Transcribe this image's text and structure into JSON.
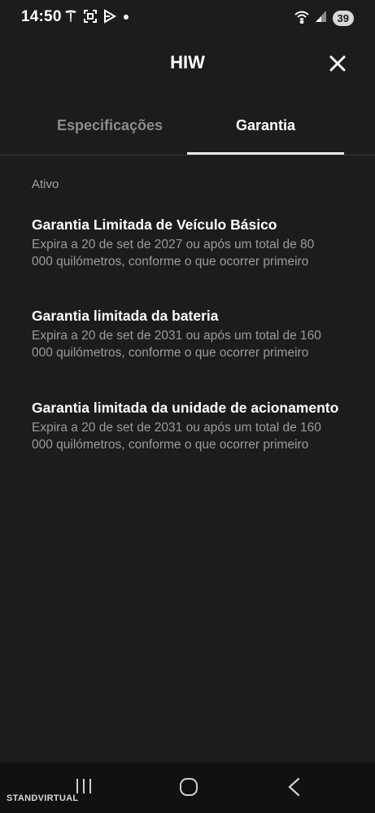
{
  "status_bar": {
    "time": "14:50",
    "left_icons": [
      "tesla-icon",
      "screenshot-icon",
      "play-icon",
      "dot-icon"
    ],
    "right_icons": [
      "wifi-icon",
      "signal-icon"
    ],
    "battery": "39"
  },
  "header": {
    "title": "HIW",
    "close_icon": "close-icon"
  },
  "tabs": [
    {
      "label": "Especificações",
      "active": false
    },
    {
      "label": "Garantia",
      "active": true
    }
  ],
  "section": {
    "label": "Ativo"
  },
  "warranties": [
    {
      "title": "Garantia Limitada de Veículo Básico",
      "description": "Expira a 20 de set de 2027 ou após um total de 80 000 quilómetros, conforme o que ocorrer primeiro"
    },
    {
      "title": "Garantia limitada da bateria",
      "description": "Expira a 20 de set de 2031 ou após um total de 160 000 quilómetros, conforme o que ocorrer primeiro"
    },
    {
      "title": "Garantia limitada da unidade de acionamento",
      "description": "Expira a 20 de set de 2031 ou após um total de 160 000 quilómetros, conforme o que ocorrer primeiro"
    }
  ],
  "nav_bar": {
    "icons": [
      "recents-icon",
      "home-icon",
      "back-icon"
    ]
  },
  "watermark": {
    "text": "STANDVIRTUAL"
  },
  "colors": {
    "background": "#1b1c1e",
    "text_primary": "#ffffff",
    "text_secondary": "#9a9b9d",
    "tab_inactive": "#8b8c8e",
    "nav_background": "#101113"
  }
}
